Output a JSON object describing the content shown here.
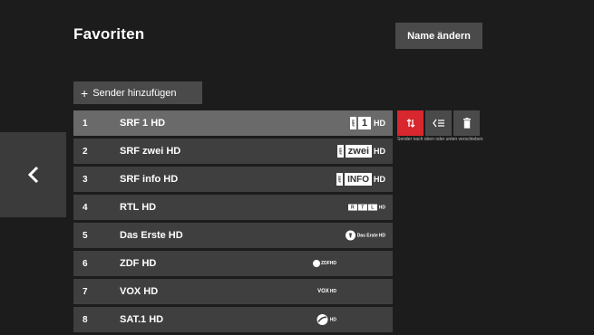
{
  "header": {
    "title": "Favoriten",
    "rename_label": "Name ändern"
  },
  "add_button": {
    "plus": "+",
    "label": "Sender hinzufügen"
  },
  "channels": [
    {
      "num": "1",
      "name": "SRF 1 HD",
      "logo": "SRF 1 HD"
    },
    {
      "num": "2",
      "name": "SRF zwei HD",
      "logo": "SRF zwei HD"
    },
    {
      "num": "3",
      "name": "SRF info HD",
      "logo": "SRF info HD"
    },
    {
      "num": "4",
      "name": "RTL HD",
      "logo": "RTL HD"
    },
    {
      "num": "5",
      "name": "Das Erste HD",
      "logo": "Das Erste HD"
    },
    {
      "num": "6",
      "name": "ZDF HD",
      "logo": "ZDF HD"
    },
    {
      "num": "7",
      "name": "VOX HD",
      "logo": "VOX HD"
    },
    {
      "num": "8",
      "name": "SAT.1 HD",
      "logo": "SAT.1 HD"
    }
  ],
  "logos": {
    "srf_tag": "SRF",
    "srf1_mark": "1",
    "hd": "HD",
    "zwei": "zwei",
    "info": "INFO",
    "rtl": [
      "R",
      "T",
      "L"
    ],
    "das_erste": "Das Erste",
    "zdf": "ZDF",
    "vox": "VOX"
  },
  "tools": {
    "move_icon": "move-up-down-icon",
    "insert_icon": "insert-list-icon",
    "delete_icon": "trash-icon"
  },
  "hint": "Sender nach oben oder unten verschieben",
  "colors": {
    "background": "#1c1c1c",
    "row": "#3f3f3f",
    "row_selected": "#6a6a6a",
    "accent": "#d8272f",
    "button": "#4a4a4a"
  }
}
